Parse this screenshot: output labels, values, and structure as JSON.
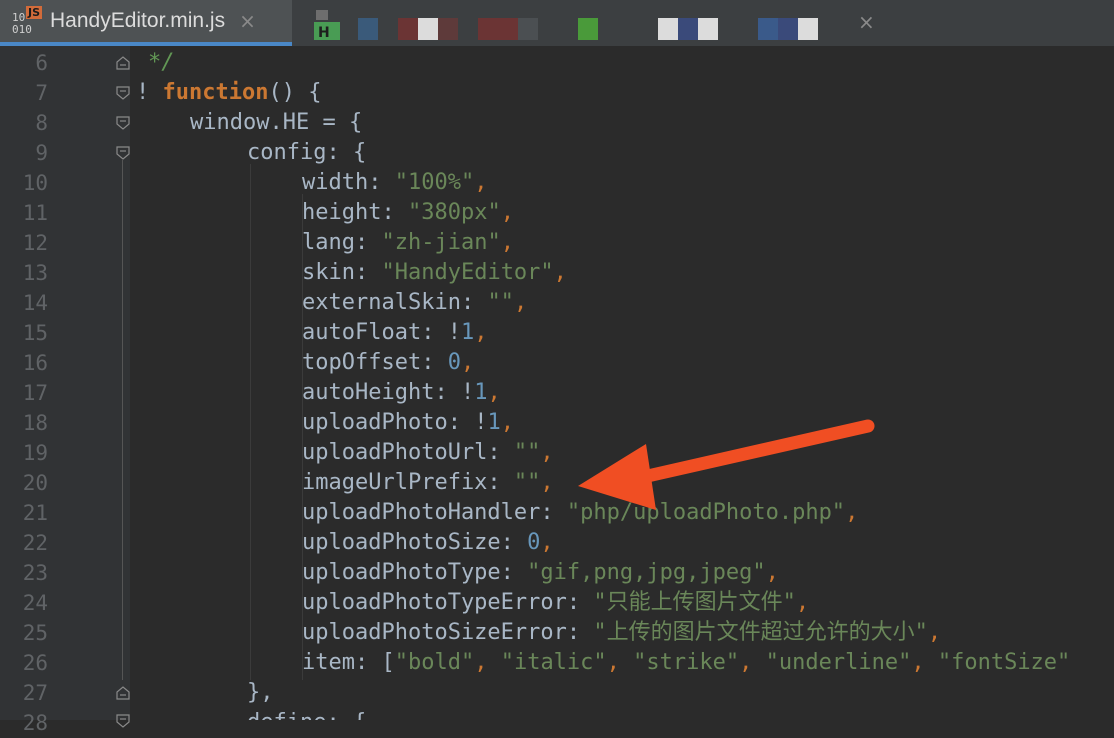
{
  "tabs": [
    {
      "title": "HandyEditor.min.js",
      "icon": "js-file-icon",
      "badge": "JS",
      "bits": [
        "10",
        "010"
      ],
      "active": true
    },
    {
      "title": "",
      "icon": "html-file-icon",
      "badge": "H",
      "active": false
    }
  ],
  "close_glyph": "×",
  "line_numbers": [
    "6",
    "7",
    "8",
    "9",
    "10",
    "11",
    "12",
    "13",
    "14",
    "15",
    "16",
    "17",
    "18",
    "19",
    "20",
    "21",
    "22",
    "23",
    "24",
    "25",
    "26",
    "27",
    "28"
  ],
  "code": {
    "l6": "*/",
    "l7_bang": "!",
    "l7_kw": "function",
    "l7_rest": "() {",
    "l8": "window.HE = {",
    "l9": "config: {",
    "l10_key": "width: ",
    "l10_val": "\"100%\"",
    "l11_key": "height: ",
    "l11_val": "\"380px\"",
    "l12_key": "lang: ",
    "l12_val": "\"zh-jian\"",
    "l13_key": "skin: ",
    "l13_val": "\"HandyEditor\"",
    "l14_key": "externalSkin: ",
    "l14_val": "\"\"",
    "l15_key": "autoFloat: ",
    "l15_pre": "!",
    "l15_val": "1",
    "l16_key": "topOffset: ",
    "l16_val": "0",
    "l17_key": "autoHeight: ",
    "l17_pre": "!",
    "l17_val": "1",
    "l18_key": "uploadPhoto: ",
    "l18_pre": "!",
    "l18_val": "1",
    "l19_key": "uploadPhotoUrl: ",
    "l19_val": "\"\"",
    "l20_key": "imageUrlPrefix: ",
    "l20_val": "\"\"",
    "l21_key": "uploadPhotoHandler: ",
    "l21_val": "\"php/uploadPhoto.php\"",
    "l22_key": "uploadPhotoSize: ",
    "l22_val": "0",
    "l23_key": "uploadPhotoType: ",
    "l23_val": "\"gif,png,jpg,jpeg\"",
    "l24_key": "uploadPhotoTypeError: ",
    "l24_val": "\"只能上传图片文件\"",
    "l25_key": "uploadPhotoSizeError: ",
    "l25_val": "\"上传的图片文件超过允许的大小\"",
    "l26_key": "item: [",
    "l26_v1": "\"bold\"",
    "l26_v2": "\"italic\"",
    "l26_v3": "\"strike\"",
    "l26_v4": "\"underline\"",
    "l26_v5": "\"fontSize\"",
    "l27": "},",
    "l28": "define: {",
    "comma": ",",
    "sep": ", "
  },
  "colors": {
    "background": "#2b2b2b",
    "keyword": "#cc7832",
    "string": "#6a8759",
    "number": "#6897bb",
    "comment": "#629755",
    "arrow": "#f04e23"
  }
}
